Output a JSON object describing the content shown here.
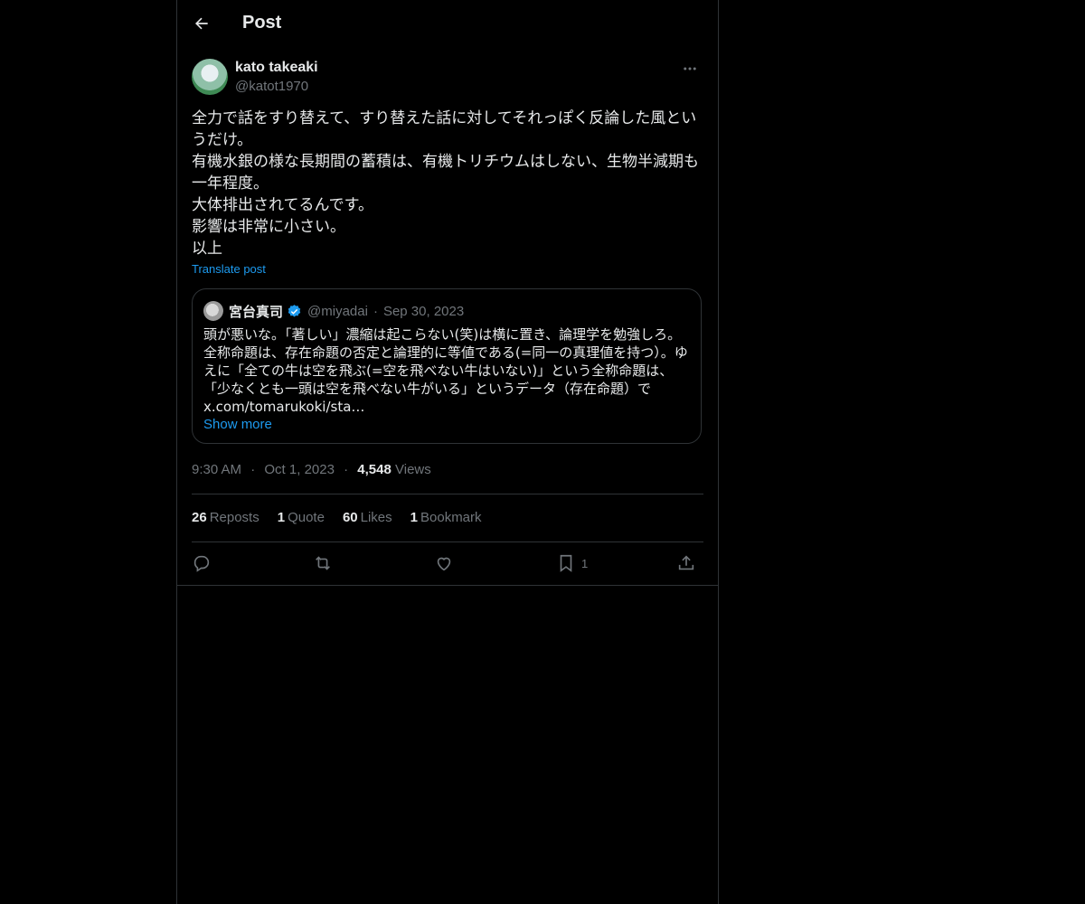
{
  "header": {
    "title": "Post"
  },
  "post": {
    "author_name": "kato takeaki",
    "author_handle": "@katot1970",
    "lines": [
      "全力で話をすり替えて、すり替えた話に対してそれっぽく反論した風というだけ。",
      "有機水銀の様な長期間の蓄積は、有機トリチウムはしない、生物半減期も一年程度。",
      "大体排出されてるんです。",
      "影響は非常に小さい。",
      "以上"
    ],
    "translate_label": "Translate post",
    "quote": {
      "name": "宮台真司",
      "handle": "@miyadai",
      "separator": "·",
      "date": "Sep 30, 2023",
      "text": "頭が悪いな。「著しい」濃縮は起こらない(笑)は横に置き、論理学を勉強しろ。全称命題は、存在命題の否定と論理的に等値である(=同一の真理値を持つ）。ゆえに「全ての牛は空を飛ぶ(=空を飛べない牛はいない)」という全称命題は、「少なくとも一頭は空を飛べない牛がいる」というデータ（存在命題）で x.com/tomarukoki/sta…",
      "show_more": "Show more"
    },
    "meta": {
      "time": "9:30 AM",
      "sep": "·",
      "date": "Oct 1, 2023",
      "views_count": "4,548",
      "views_label": "Views"
    },
    "stats": [
      {
        "count": "26",
        "label": "Reposts"
      },
      {
        "count": "1",
        "label": "Quote"
      },
      {
        "count": "60",
        "label": "Likes"
      },
      {
        "count": "1",
        "label": "Bookmark"
      }
    ],
    "actions": {
      "bookmark_count": "1"
    }
  },
  "colors": {
    "background": "#000000",
    "text": "#e7e9ea",
    "muted": "#71767b",
    "accent": "#1d9bf0",
    "border": "#2f3336"
  },
  "icons": [
    "back-arrow-icon",
    "more-icon",
    "verified-badge-icon",
    "reply-icon",
    "repost-icon",
    "like-icon",
    "bookmark-icon",
    "share-icon"
  ]
}
